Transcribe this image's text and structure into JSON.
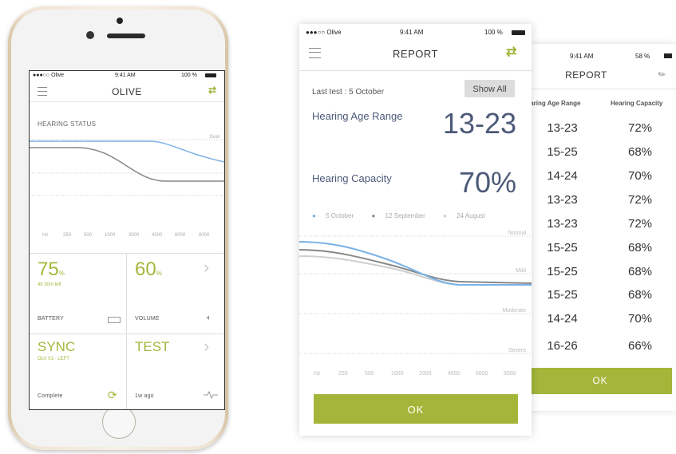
{
  "device": {
    "status": {
      "carrier": "●●●○○ Olive",
      "time": "9:41 AM",
      "battery": "100 %"
    },
    "header": {
      "title": "OLIVE"
    },
    "hearing_status": {
      "label": "HEARING STATUS",
      "goal_label": "Goal",
      "frequencies": [
        "Hz",
        "250",
        "500",
        "1000",
        "3000",
        "4000",
        "6000",
        "8000"
      ]
    },
    "battery": {
      "value": "75",
      "unit": "%",
      "sub": "4h 30m left",
      "label": "BATTERY",
      "level": 0.75
    },
    "volume": {
      "value": "60",
      "unit": "%",
      "label": "VOLUME",
      "level": 0.6
    },
    "sync": {
      "value": "SYNC",
      "sub": "OLV 01 · LEFT",
      "status": "Complete"
    },
    "test": {
      "value": "TEST",
      "status": "1w ago"
    },
    "accent_color": "#a6b63c"
  },
  "report": {
    "status": {
      "carrier": "●●●○○ Olive",
      "time": "9:41 AM",
      "battery": "100 %"
    },
    "title": "REPORT",
    "last_test": "Last test : 5 October",
    "show_all": "Show All",
    "age_label": "Hearing Age Range",
    "age_value": "13-23",
    "capacity_label": "Hearing Capacity",
    "capacity_value": "70%",
    "legend": [
      {
        "label": "5 October",
        "color": "#7ab1e6"
      },
      {
        "label": "12 September",
        "color": "#888888"
      },
      {
        "label": "24 August",
        "color": "#cccccc"
      }
    ],
    "levels": [
      "Normal",
      "Mild",
      "Moderate",
      "Severe"
    ],
    "frequencies": [
      "Hz",
      "250",
      "500",
      "1000",
      "2000",
      "4000",
      "6000",
      "8000"
    ],
    "ok": "OK"
  },
  "history": {
    "status": {
      "time": "9:41 AM",
      "battery": "58 %"
    },
    "title": "REPORT",
    "col_age": "Hearing Age Range",
    "col_capacity": "Hearing Capacity",
    "rows": [
      {
        "age": "13-23",
        "capacity": "72%"
      },
      {
        "age": "15-25",
        "capacity": "68%"
      },
      {
        "age": "14-24",
        "capacity": "70%"
      },
      {
        "age": "13-23",
        "capacity": "72%"
      },
      {
        "age": "13-23",
        "capacity": "72%"
      },
      {
        "age": "15-25",
        "capacity": "68%"
      },
      {
        "age": "15-25",
        "capacity": "68%"
      },
      {
        "age": "15-25",
        "capacity": "68%"
      },
      {
        "age": "14-24",
        "capacity": "70%"
      },
      {
        "age": "16-26",
        "capacity": "66%"
      }
    ],
    "ok": "OK"
  }
}
